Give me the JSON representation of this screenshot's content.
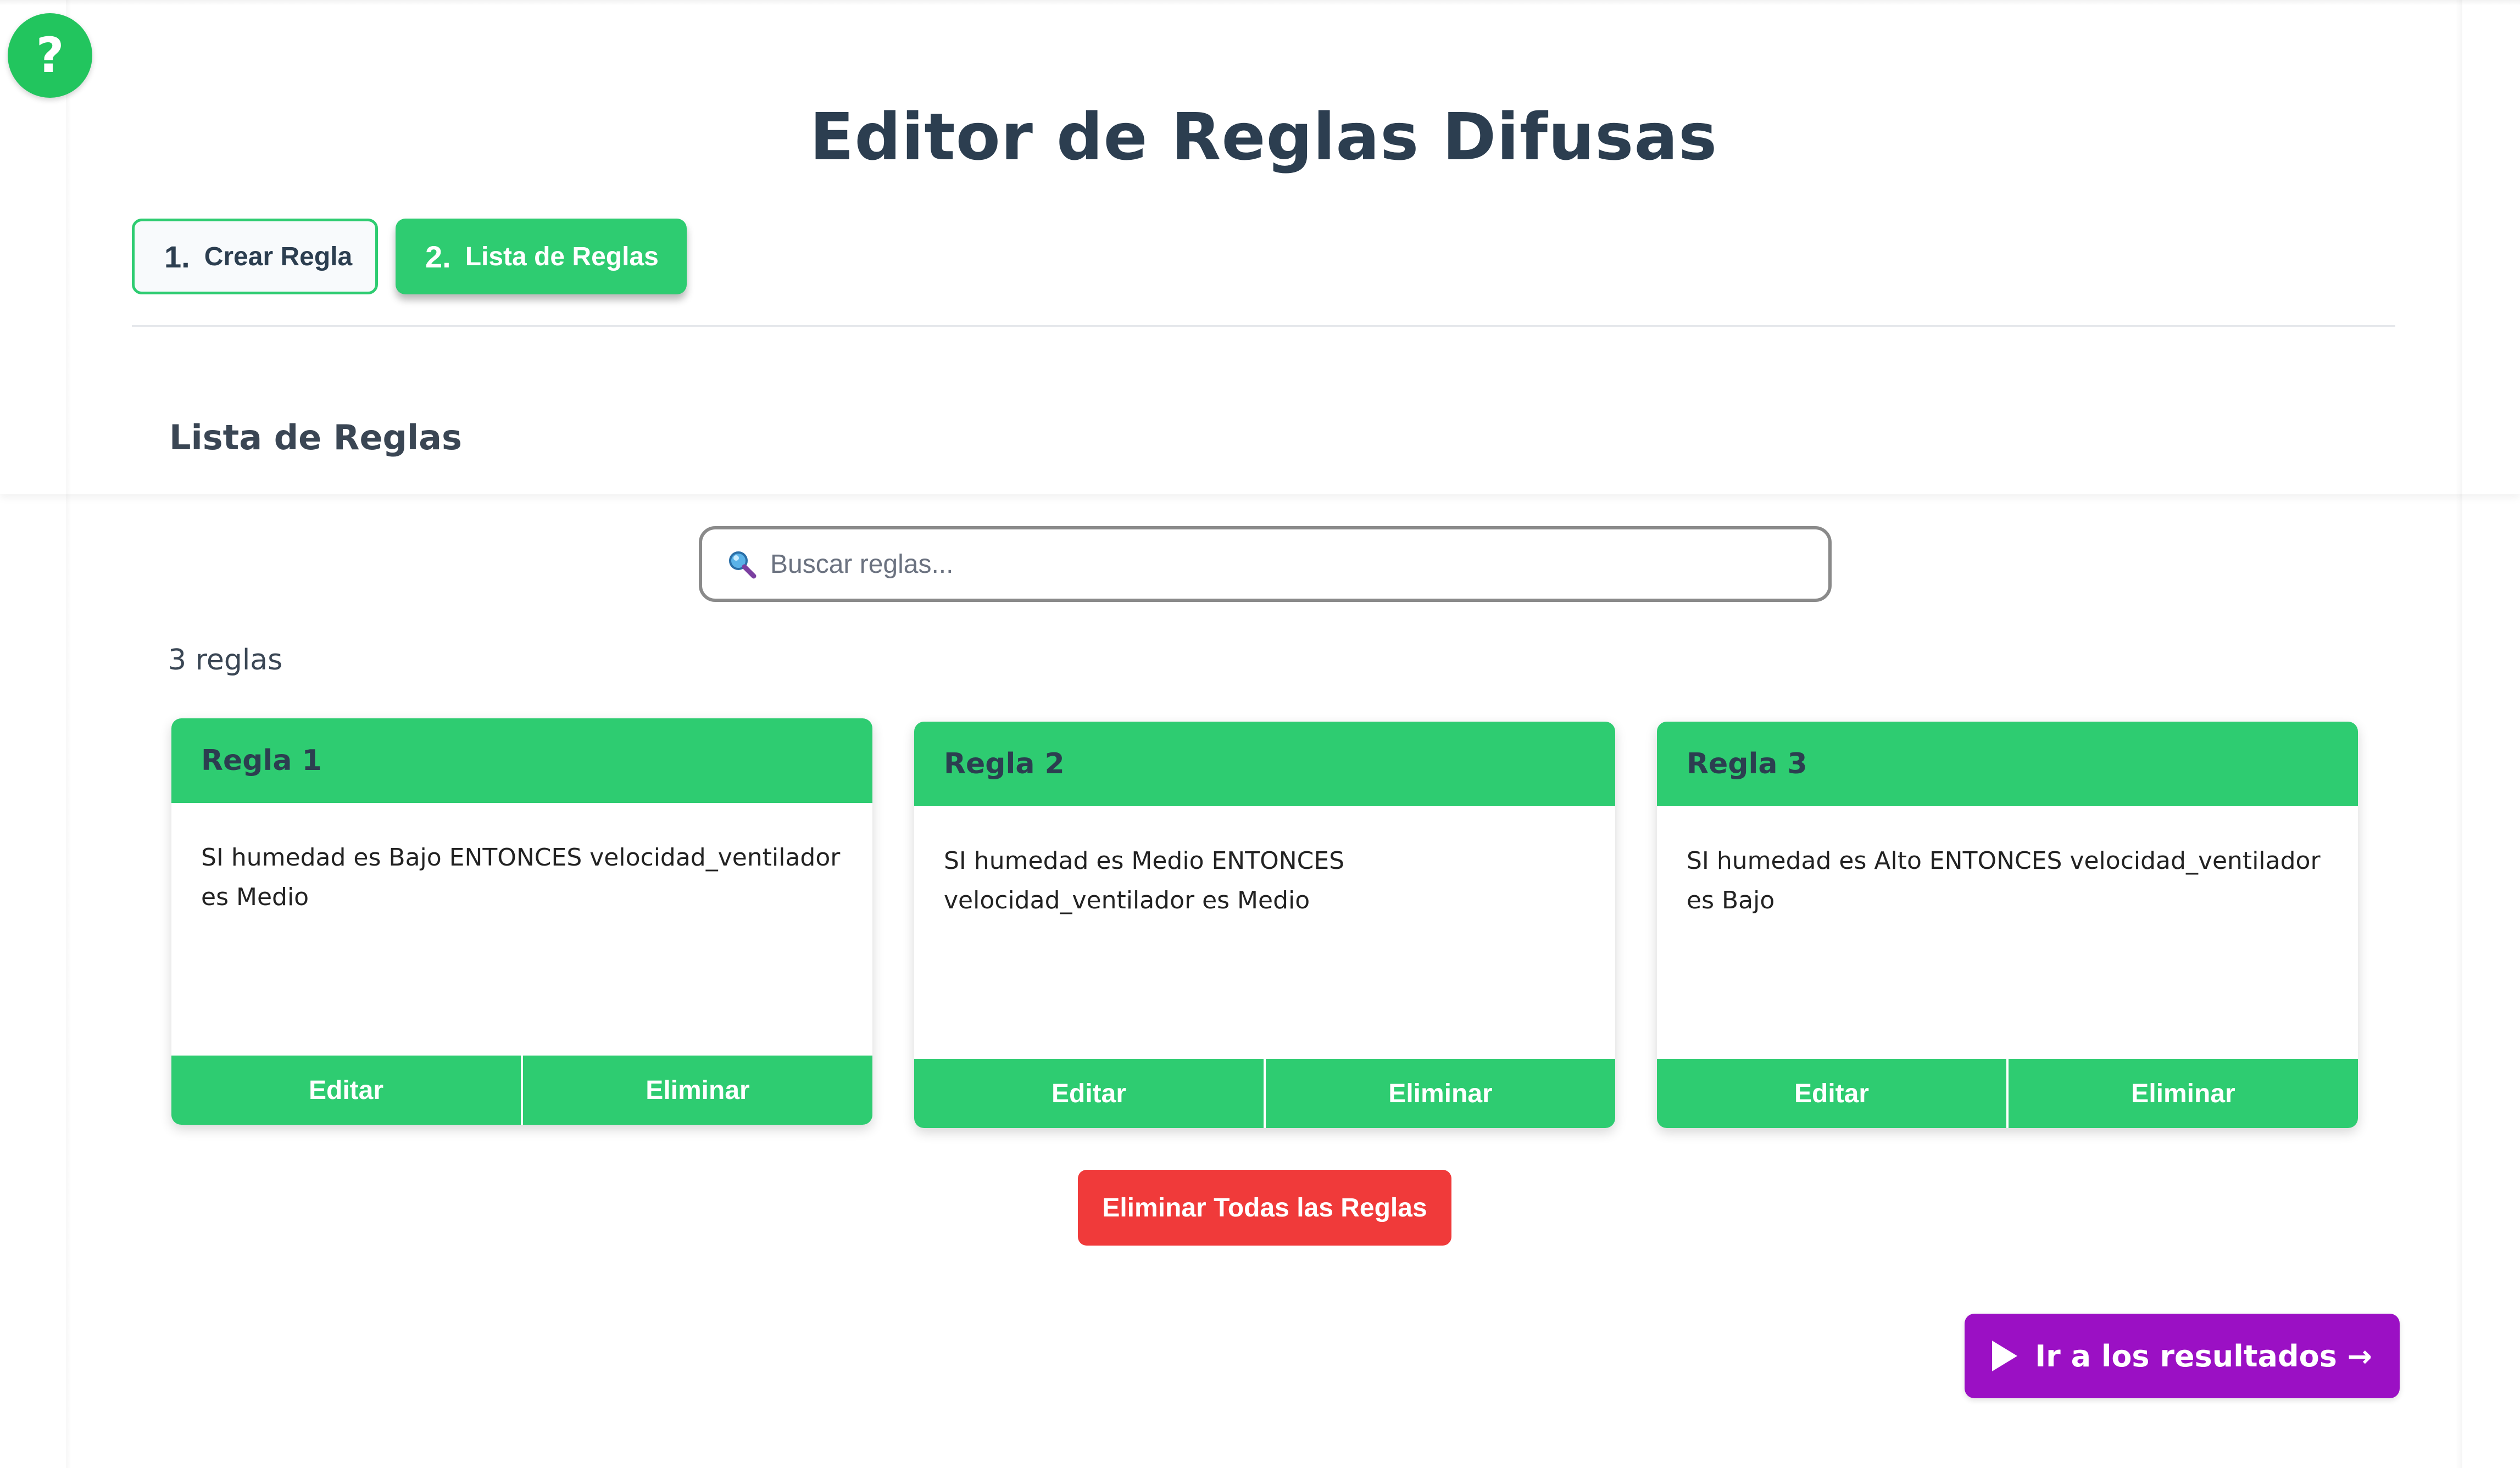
{
  "help": {
    "label": "?"
  },
  "header": {
    "title": "Editor de Reglas Difusas"
  },
  "tabs": [
    {
      "number": "1.",
      "label": "Crear Regla"
    },
    {
      "number": "2.",
      "label": "Lista de Reglas"
    }
  ],
  "section": {
    "title": "Lista de Reglas"
  },
  "search": {
    "placeholder": "Buscar reglas..."
  },
  "rules_count": "3 reglas",
  "rules": [
    {
      "title": "Regla 1",
      "text": "SI humedad es Bajo ENTONCES velocidad_ventilador es Medio",
      "edit_label": "Editar",
      "delete_label": "Eliminar"
    },
    {
      "title": "Regla 2",
      "text": "SI humedad es Medio ENTONCES velocidad_ventilador es Medio",
      "edit_label": "Editar",
      "delete_label": "Eliminar"
    },
    {
      "title": "Regla 3",
      "text": "SI humedad es Alto ENTONCES velocidad_ventilador es Bajo",
      "edit_label": "Editar",
      "delete_label": "Eliminar"
    }
  ],
  "actions": {
    "delete_all_label": "Eliminar Todas las Reglas",
    "results_label": "Ir a los resultados →"
  },
  "colors": {
    "accent_green": "#2ecc71",
    "danger_red": "#f03a3a",
    "results_purple": "#9b10c4"
  }
}
